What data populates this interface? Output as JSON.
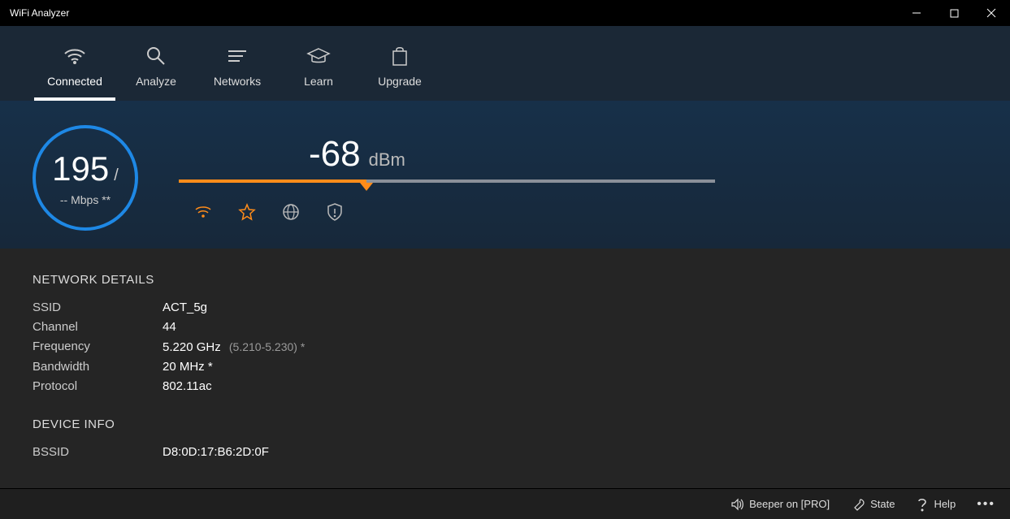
{
  "app_title": "WiFi Analyzer",
  "nav": {
    "connected": "Connected",
    "analyze": "Analyze",
    "networks": "Networks",
    "learn": "Learn",
    "upgrade": "Upgrade"
  },
  "hero": {
    "link_speed": "195",
    "link_speed_slash": "/",
    "link_speed_sub": "-- Mbps **",
    "signal_dbm": "-68",
    "signal_unit": "dBm",
    "signal_fill_percent": 35
  },
  "network_details": {
    "title": "NETWORK DETAILS",
    "rows": {
      "ssid_label": "SSID",
      "ssid_value": "ACT_5g",
      "channel_label": "Channel",
      "channel_value": "44",
      "frequency_label": "Frequency",
      "frequency_value": "5.220 GHz",
      "frequency_sub": "(5.210-5.230) *",
      "bandwidth_label": "Bandwidth",
      "bandwidth_value": "20 MHz *",
      "protocol_label": "Protocol",
      "protocol_value": "802.11ac"
    }
  },
  "device_info": {
    "title": "DEVICE INFO",
    "bssid_label": "BSSID",
    "bssid_value": "D8:0D:17:B6:2D:0F"
  },
  "footer": {
    "beeper": "Beeper on [PRO]",
    "state": "State",
    "help": "Help"
  },
  "chart_data": {
    "type": "bar",
    "title": "Signal strength",
    "value_dbm": -68,
    "range_dbm": [
      -100,
      0
    ],
    "fill_percent": 35,
    "unit": "dBm"
  }
}
